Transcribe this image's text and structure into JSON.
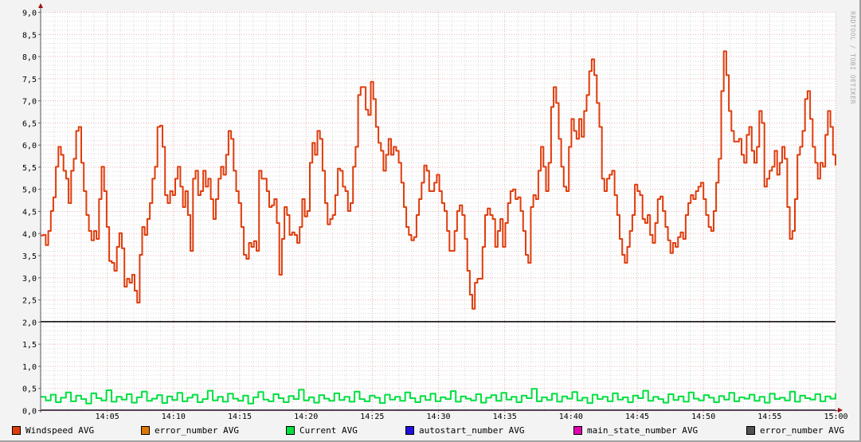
{
  "chart_data": {
    "type": "line",
    "title": "",
    "watermark": "RRDTOOL / TOBI OETIKER",
    "xlabel": "",
    "ylabel": "",
    "x_range_minutes": [
      0,
      60
    ],
    "x_start_time": "14:00",
    "x_tick_labels": [
      "14:05",
      "14:10",
      "14:15",
      "14:20",
      "14:25",
      "14:30",
      "14:35",
      "14:40",
      "14:45",
      "14:50",
      "14:55",
      "15:00"
    ],
    "ylim": [
      0,
      9
    ],
    "y_tick_labels": [
      "0,0",
      "0,5",
      "1,0",
      "1,5",
      "2,0",
      "2,5",
      "3,0",
      "3,5",
      "4,0",
      "4,5",
      "5,0",
      "5,5",
      "6,0",
      "6,5",
      "7,0",
      "7,5",
      "8,0",
      "8,5",
      "9,0"
    ],
    "grid": true,
    "hrule": {
      "value": 2.0,
      "color": "#000000"
    },
    "legend_position": "bottom",
    "legend": [
      {
        "label": "Windspeed AVG",
        "color": "#e03c0c"
      },
      {
        "label": "error_number AVG",
        "color": "#e07800"
      },
      {
        "label": "Current AVG",
        "color": "#00e040"
      },
      {
        "label": "autostart_number AVG",
        "color": "#2010e0"
      },
      {
        "label": "main_state_number AVG",
        "color": "#e000b0"
      },
      {
        "label": "error_number AVG",
        "color": "#505050"
      }
    ],
    "series": [
      {
        "name": "Windspeed AVG",
        "color": "#e03c0c",
        "values": [
          3.95,
          3.96,
          3.73,
          4.05,
          4.5,
          4.81,
          5.5,
          5.95,
          5.77,
          5.41,
          5.23,
          4.68,
          5.41,
          5.68,
          6.31,
          6.4,
          5.59,
          4.95,
          4.41,
          4.05,
          3.84,
          4.05,
          3.87,
          4.77,
          5.5,
          4.95,
          4.14,
          3.37,
          3.33,
          3.15,
          3.69,
          4.0,
          3.66,
          2.79,
          2.97,
          2.88,
          3.06,
          2.7,
          2.43,
          3.51,
          4.14,
          3.96,
          4.32,
          4.68,
          5.23,
          5.5,
          6.4,
          6.43,
          5.95,
          4.86,
          4.68,
          4.95,
          4.86,
          5.23,
          5.5,
          5.05,
          4.59,
          4.95,
          4.41,
          3.6,
          5.23,
          5.41,
          4.86,
          4.95,
          5.41,
          5.05,
          5.23,
          4.77,
          4.32,
          4.77,
          5.23,
          5.5,
          5.32,
          5.77,
          6.31,
          6.13,
          5.41,
          4.95,
          4.68,
          4.14,
          3.51,
          3.42,
          3.78,
          3.69,
          3.82,
          3.6,
          5.41,
          5.23,
          5.23,
          4.95,
          4.59,
          4.63,
          4.77,
          4.23,
          3.06,
          3.87,
          4.59,
          4.41,
          3.96,
          4.02,
          3.96,
          3.78,
          4.14,
          4.77,
          4.38,
          4.5,
          5.59,
          6.04,
          5.77,
          6.31,
          6.13,
          5.41,
          4.68,
          4.2,
          4.32,
          4.41,
          4.86,
          5.46,
          5.41,
          5.05,
          4.95,
          4.5,
          4.68,
          5.5,
          5.95,
          7.12,
          7.3,
          7.3,
          6.79,
          6.67,
          7.42,
          7.03,
          6.4,
          6.04,
          5.86,
          5.41,
          5.77,
          6.13,
          5.77,
          5.95,
          5.86,
          5.59,
          5.14,
          4.59,
          4.14,
          3.96,
          3.84,
          3.91,
          4.41,
          4.77,
          5.14,
          5.53,
          5.41,
          4.95,
          4.95,
          5.14,
          5.32,
          4.95,
          4.68,
          4.5,
          4.05,
          3.6,
          3.6,
          4.05,
          4.5,
          4.63,
          4.41,
          3.87,
          3.15,
          2.61,
          2.29,
          2.88,
          2.97,
          2.97,
          3.69,
          4.41,
          4.56,
          4.41,
          4.32,
          3.69,
          4.05,
          4.32,
          3.69,
          4.23,
          4.68,
          4.95,
          4.99,
          4.77,
          4.81,
          4.5,
          4.05,
          3.51,
          3.33,
          4.59,
          4.86,
          4.77,
          5.41,
          5.95,
          5.5,
          4.95,
          5.59,
          6.85,
          7.3,
          6.94,
          6.13,
          5.5,
          5.05,
          4.95,
          5.95,
          6.58,
          6.31,
          6.13,
          6.58,
          6.18,
          6.76,
          7.12,
          7.66,
          7.93,
          7.57,
          6.94,
          6.4,
          5.23,
          4.95,
          5.23,
          5.32,
          5.41,
          4.86,
          4.41,
          3.87,
          3.51,
          3.33,
          3.69,
          4.05,
          4.41,
          5.1,
          4.95,
          4.86,
          4.32,
          4.23,
          4.41,
          3.96,
          3.78,
          4.23,
          4.77,
          4.83,
          4.5,
          4.14,
          3.84,
          3.55,
          3.78,
          3.69,
          3.91,
          4.02,
          3.87,
          4.41,
          4.68,
          4.86,
          4.77,
          4.95,
          5.05,
          5.14,
          4.77,
          4.41,
          4.14,
          4.05,
          4.5,
          5.14,
          5.68,
          7.21,
          8.11,
          7.57,
          6.76,
          6.31,
          6.07,
          6.07,
          6.13,
          5.77,
          5.59,
          6.22,
          6.4,
          5.86,
          5.59,
          5.95,
          6.76,
          6.49,
          5.05,
          5.23,
          5.41,
          5.5,
          5.86,
          5.32,
          5.59,
          5.95,
          5.68,
          4.59,
          3.87,
          4.05,
          4.77,
          5.77,
          5.95,
          6.31,
          7.03,
          7.21,
          6.58,
          5.95,
          5.59,
          5.23,
          5.59,
          5.5,
          6.22,
          6.76,
          6.4,
          5.77,
          5.53
        ]
      },
      {
        "name": "Current AVG",
        "color": "#00e040",
        "values": [
          0.3,
          0.22,
          0.35,
          0.18,
          0.28,
          0.4,
          0.2,
          0.33,
          0.25,
          0.15,
          0.38,
          0.27,
          0.22,
          0.45,
          0.19,
          0.3,
          0.24,
          0.36,
          0.17,
          0.29,
          0.42,
          0.21,
          0.26,
          0.34,
          0.16,
          0.31,
          0.23,
          0.39,
          0.2,
          0.28,
          0.35,
          0.18,
          0.25,
          0.44,
          0.22,
          0.3,
          0.19,
          0.37,
          0.26,
          0.21,
          0.33,
          0.15,
          0.29,
          0.41,
          0.24,
          0.2,
          0.36,
          0.27,
          0.18,
          0.32,
          0.25,
          0.46,
          0.22,
          0.29,
          0.17,
          0.34,
          0.26,
          0.21,
          0.38,
          0.23,
          0.3,
          0.19,
          0.42,
          0.25,
          0.2,
          0.33,
          0.28,
          0.16,
          0.35,
          0.24,
          0.3,
          0.21,
          0.4,
          0.27,
          0.18,
          0.32,
          0.23,
          0.37,
          0.2,
          0.29,
          0.25,
          0.43,
          0.19,
          0.31,
          0.26,
          0.22,
          0.36,
          0.17,
          0.28,
          0.34,
          0.21,
          0.39,
          0.24,
          0.3,
          0.18,
          0.33,
          0.27,
          0.48,
          0.2,
          0.29,
          0.23,
          0.37,
          0.19,
          0.31,
          0.26,
          0.41,
          0.22,
          0.28,
          0.16,
          0.35,
          0.25,
          0.3,
          0.2,
          0.38,
          0.24,
          0.29,
          0.18,
          0.33,
          0.27,
          0.44,
          0.21,
          0.3,
          0.25,
          0.17,
          0.36,
          0.23,
          0.31,
          0.19,
          0.4,
          0.26,
          0.22,
          0.34,
          0.28,
          0.18,
          0.32,
          0.24,
          0.39,
          0.2,
          0.29,
          0.26,
          0.35,
          0.21,
          0.3,
          0.17,
          0.37,
          0.25,
          0.28,
          0.22,
          0.42,
          0.19,
          0.33,
          0.27,
          0.24,
          0.36,
          0.2,
          0.31,
          0.26,
          0.38
        ]
      },
      {
        "name": "error_number AVG",
        "color": "#505050",
        "values": [
          0,
          0
        ]
      }
    ]
  }
}
